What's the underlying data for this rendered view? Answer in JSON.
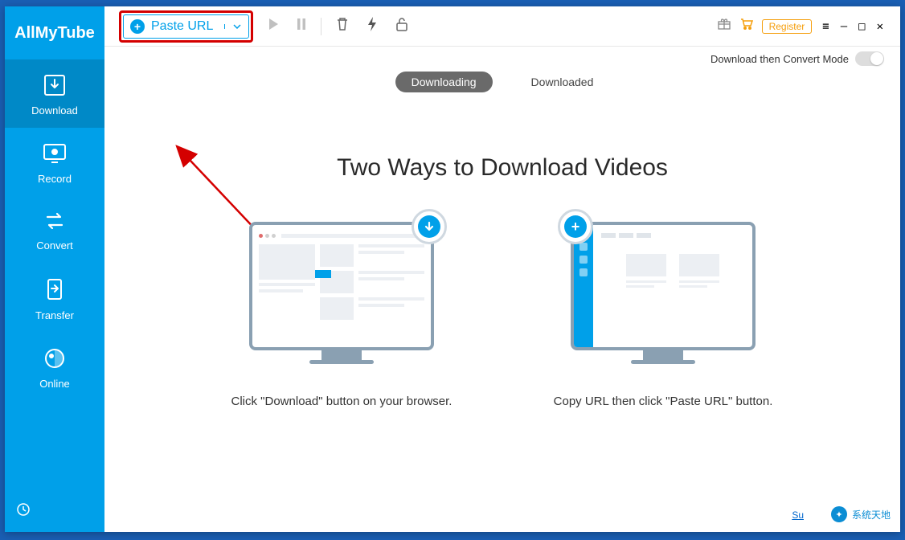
{
  "app": {
    "name": "AllMyTube"
  },
  "sidebar": {
    "items": [
      {
        "label": "Download"
      },
      {
        "label": "Record"
      },
      {
        "label": "Convert"
      },
      {
        "label": "Transfer"
      },
      {
        "label": "Online"
      }
    ]
  },
  "toolbar": {
    "paste_url": "Paste URL",
    "register": "Register",
    "convert_mode": "Download then Convert Mode"
  },
  "tabs": {
    "downloading": "Downloading",
    "downloaded": "Downloaded"
  },
  "content": {
    "heading": "Two Ways to Download Videos",
    "way1": "Click \"Download\" button on your browser.",
    "way2": "Copy URL then click \"Paste URL\" button."
  },
  "footer": {
    "support": "Su",
    "watermark": "系统天地"
  }
}
